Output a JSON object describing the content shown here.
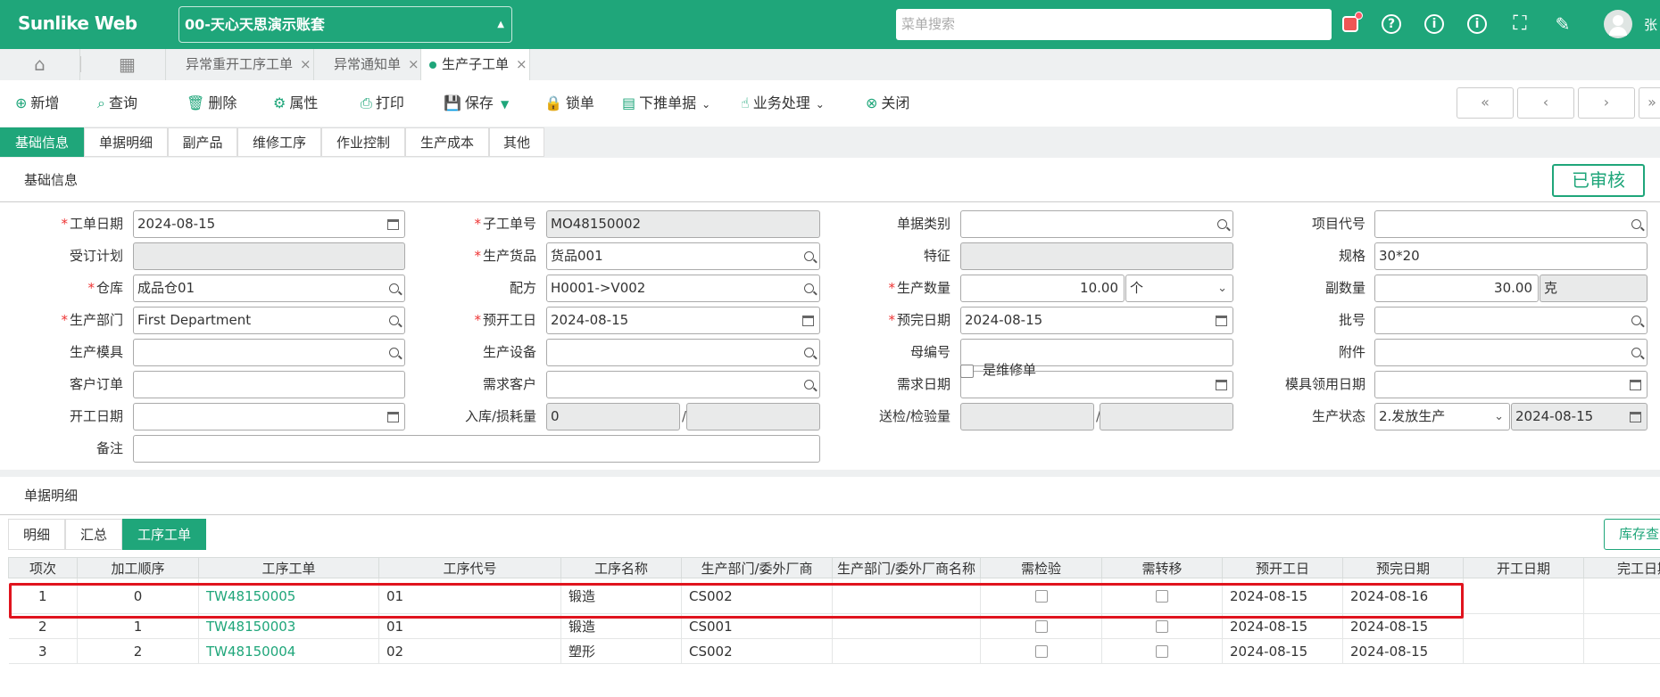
{
  "app": {
    "brand": "Sunlike Web",
    "account": "00-天心天思演示账套",
    "menu_search_placeholder": "菜单搜索",
    "user": "张"
  },
  "tabs": [
    {
      "label": "异常重开工序工单"
    },
    {
      "label": "异常通知单"
    },
    {
      "label": "生产子工单"
    }
  ],
  "toolbar": {
    "add": "新增",
    "query": "查询",
    "delete": "删除",
    "properties": "属性",
    "print": "打印",
    "save": "保存",
    "lock": "锁单",
    "push": "下推单据",
    "business": "业务处理",
    "close": "关闭"
  },
  "page_tabs": [
    "基础信息",
    "单据明细",
    "副产品",
    "维修工序",
    "作业控制",
    "生产成本",
    "其他"
  ],
  "section_basic": "基础信息",
  "status_stamp": "已审核",
  "form": {
    "l_work_date": "工单日期",
    "v_work_date": "2024-08-15",
    "l_sub_no": "子工单号",
    "v_sub_no": "MO48150002",
    "l_doc_type": "单据类别",
    "v_doc_type": "",
    "l_project": "项目代号",
    "v_project": "",
    "l_order_plan": "受订计划",
    "v_order_plan": "",
    "l_product": "生产货品",
    "v_product": "货品001",
    "l_feature": "特征",
    "v_feature": "",
    "l_spec": "规格",
    "v_spec": "30*20",
    "l_warehouse": "仓库",
    "v_warehouse": "成品仓01",
    "l_formula": "配方",
    "v_formula": "H0001->V002",
    "l_qty": "生产数量",
    "v_qty": "10.00",
    "v_unit": "个",
    "l_sub_qty": "副数量",
    "v_sub_qty": "30.00",
    "v_sub_unit": "克",
    "l_dept": "生产部门",
    "v_dept": "First Department",
    "l_plan_start": "预开工日",
    "v_plan_start": "2024-08-15",
    "l_plan_end": "预完日期",
    "v_plan_end": "2024-08-15",
    "l_batch": "批号",
    "v_batch": "",
    "l_mold": "生产模具",
    "v_mold": "",
    "l_device": "生产设备",
    "v_device": "",
    "l_parent_no": "母编号",
    "v_parent_no": "",
    "l_attach": "附件",
    "v_attach": "",
    "l_cust_order": "客户订单",
    "v_cust_order": "",
    "l_demand_cust": "需求客户",
    "v_demand_cust": "",
    "l_demand_date": "需求日期",
    "v_demand_date": "",
    "l_mold_date": "模具领用日期",
    "v_mold_date": "",
    "l_start_date": "开工日期",
    "v_start_date": "",
    "l_in_loss": "入库/损耗量",
    "v_in_qty": "0",
    "v_loss_qty": "",
    "l_inspect": "送检/检验量",
    "v_inspect_send": "",
    "v_inspect_done": "",
    "l_status": "生产状态",
    "v_status": "2.发放生产",
    "v_status_date": "2024-08-15",
    "l_remark": "备注",
    "v_remark": "",
    "repair_label": "是维修单",
    "slash": "/"
  },
  "section_detail": "单据明细",
  "sub_tabs": [
    "明细",
    "汇总",
    "工序工单"
  ],
  "stock_button": "库存查",
  "grid": {
    "headers": [
      "项次",
      "加工顺序",
      "工序工单",
      "工序代号",
      "工序名称",
      "生产部门/委外厂商",
      "生产部门/委外厂商名称",
      "需检验",
      "需转移",
      "预开工日",
      "预完日期",
      "开工日期",
      "完工日期"
    ],
    "rows": [
      {
        "no": "1",
        "seq": "0",
        "order": "TW48150005",
        "code": "01",
        "name": "锻造",
        "dept": "CS002",
        "dept_name": "",
        "start": "2024-08-15",
        "end": "2024-08-16",
        "actual_start": "",
        "actual_end": ""
      },
      {
        "no": "2",
        "seq": "1",
        "order": "TW48150003",
        "code": "01",
        "name": "锻造",
        "dept": "CS001",
        "dept_name": "",
        "start": "2024-08-15",
        "end": "2024-08-15",
        "actual_start": "",
        "actual_end": ""
      },
      {
        "no": "3",
        "seq": "2",
        "order": "TW48150004",
        "code": "02",
        "name": "塑形",
        "dept": "CS002",
        "dept_name": "",
        "start": "2024-08-15",
        "end": "2024-08-15",
        "actual_start": "",
        "actual_end": ""
      }
    ]
  },
  "colors": {
    "accent": "#1fa67a",
    "highlight": "#e0141e"
  }
}
